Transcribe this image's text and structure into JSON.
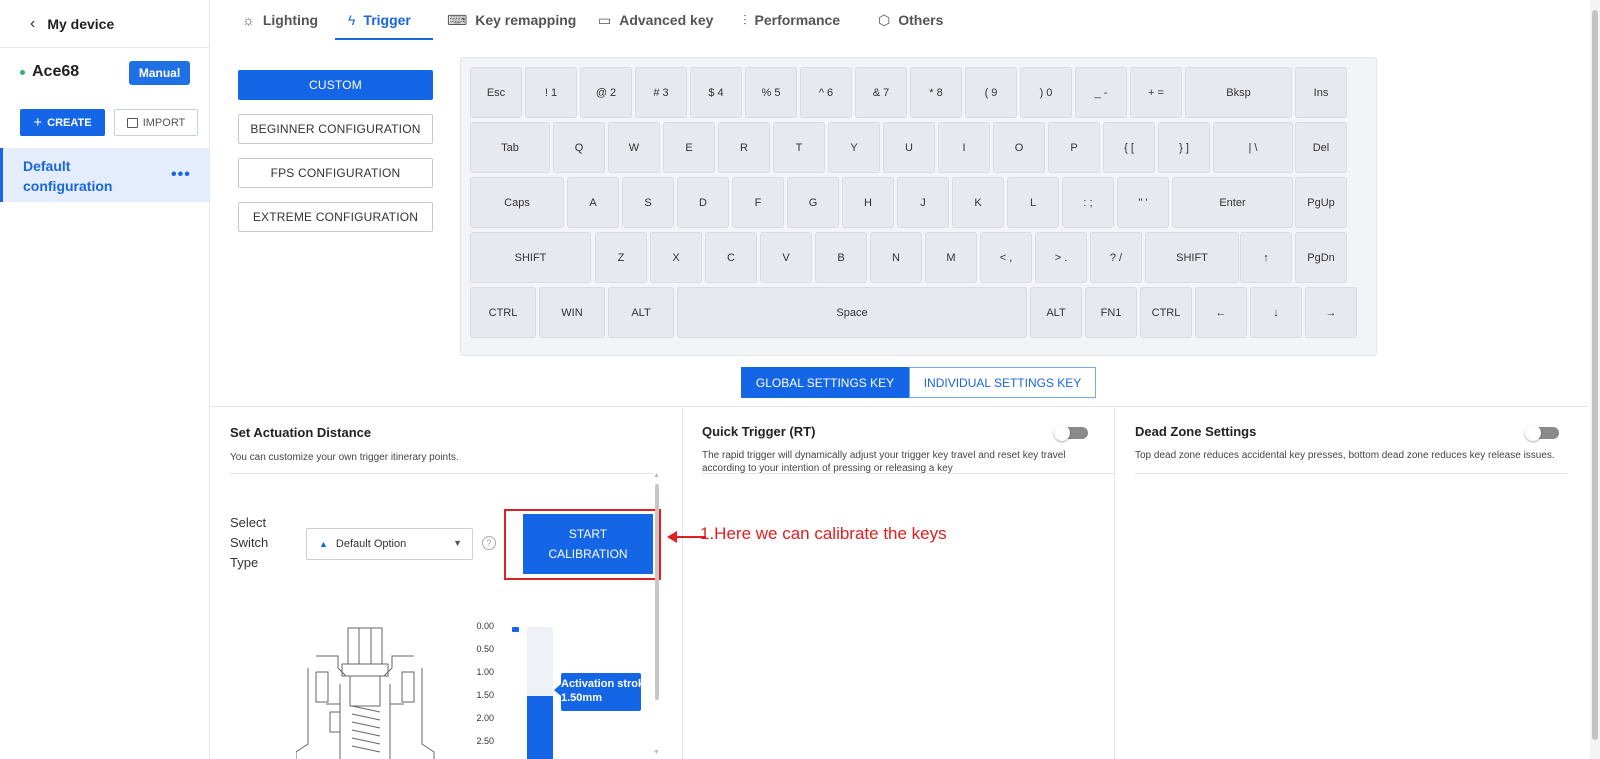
{
  "sidebar": {
    "back_label": "My device",
    "device_name": "Ace68",
    "mode_badge": "Manual",
    "create_label": "CREATE",
    "import_label": "IMPORT",
    "configs": [
      {
        "label": "Default configuration",
        "more": "•••"
      }
    ]
  },
  "tabs": [
    {
      "label": "Lighting",
      "icon": "lightbulb-icon",
      "glyph": "💡"
    },
    {
      "label": "Trigger",
      "icon": "lightning-icon",
      "glyph": "ϟ"
    },
    {
      "label": "Key remapping",
      "icon": "keyboard-icon",
      "glyph": "⌨"
    },
    {
      "label": "Advanced key",
      "icon": "advanced-key-icon",
      "glyph": "▭"
    },
    {
      "label": "Performance",
      "icon": "sliders-icon",
      "glyph": "⫶"
    },
    {
      "label": "Others",
      "icon": "hexagon-settings-icon",
      "glyph": "⬡"
    }
  ],
  "active_tab": "Trigger",
  "config_buttons": [
    "CUSTOM",
    "BEGINNER CONFIGURATION",
    "FPS CONFIGURATION",
    "EXTREME CONFIGURATION"
  ],
  "active_config_button": "CUSTOM",
  "keyboard": {
    "rows": [
      [
        "Esc",
        "! 1",
        "@ 2",
        "# 3",
        "$ 4",
        "% 5",
        "^ 6",
        "& 7",
        "* 8",
        "( 9",
        ") 0",
        "_ -",
        "+ =",
        "Bksp",
        "Ins"
      ],
      [
        "Tab",
        "Q",
        "W",
        "E",
        "R",
        "T",
        "Y",
        "U",
        "I",
        "O",
        "P",
        "{ [",
        "} ]",
        "| \\",
        "Del"
      ],
      [
        "Caps",
        "A",
        "S",
        "D",
        "F",
        "G",
        "H",
        "J",
        "K",
        "L",
        ": ;",
        "\" '",
        "Enter",
        "PgUp"
      ],
      [
        "SHIFT",
        "Z",
        "X",
        "C",
        "V",
        "B",
        "N",
        "M",
        "< ,",
        "> .",
        "? /",
        "SHIFT",
        "↑",
        "PgDn"
      ],
      [
        "CTRL",
        "WIN",
        "ALT",
        "Space",
        "ALT",
        "FN1",
        "CTRL",
        "←",
        "↓",
        "→"
      ]
    ]
  },
  "settings_mode": {
    "global": "GLOBAL SETTINGS KEY",
    "individual": "INDIVIDUAL SETTINGS KEY",
    "active": "global"
  },
  "actuation": {
    "title": "Set Actuation Distance",
    "desc": "You can customize your own trigger itinerary points.",
    "switch_label": "Select Switch Type",
    "switch_value": "Default Option",
    "help": "?",
    "calibrate_label": "START CALIBRATION",
    "scale_ticks": [
      "0.00",
      "0.50",
      "1.00",
      "1.50",
      "2.00",
      "2.50"
    ],
    "activation_stroke_label": "Activation stroke",
    "activation_stroke_value": "1.50mm",
    "activation_mm": 1.5,
    "scale_max_mm": 2.5
  },
  "annotation": {
    "text": "1.Here we can calibrate the keys",
    "color": "#e02020"
  },
  "quick_trigger": {
    "title": "Quick Trigger (RT)",
    "desc": "The rapid trigger will dynamically adjust your trigger key travel and reset key travel according to your intention of pressing or releasing a key",
    "enabled": false
  },
  "dead_zone": {
    "title": "Dead Zone Settings",
    "desc": "Top dead zone reduces accidental key presses, bottom dead zone reduces key release issues.",
    "enabled": false
  },
  "colors": {
    "accent": "#1566e6",
    "online": "#2bb673",
    "annotation": "#e02020"
  }
}
